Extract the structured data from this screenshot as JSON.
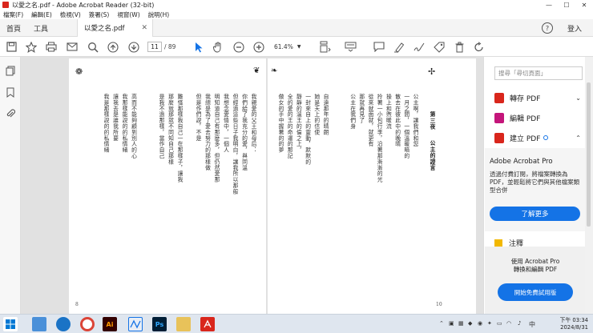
{
  "window": {
    "title": "以愛之名.pdf - Adobe Acrobat Reader (32-bit)",
    "min": "—",
    "max": "☐",
    "close": "✕"
  },
  "menu": [
    "檔案(F)",
    "編輯(E)",
    "檢視(V)",
    "簽署(S)",
    "視窗(W)",
    "說明(H)"
  ],
  "tabs": {
    "home": "首頁",
    "tools": "工具",
    "doc": "以愛之名.pdf",
    "help": "?",
    "login": "登入"
  },
  "toolbar": {
    "page_current": "11",
    "page_total": "/ 89",
    "zoom": "61.4%"
  },
  "page_left": {
    "number": "8",
    "columns": [
      "我親愛的父王和母后：",
      "你們給了我充分的愛，與同溫",
      "但經過這些日子我明白，讓我所以那般",
      "我想念愛情中，一個人",
      "明知道自己有那麼多，但仍然愛那",
      "我總是為了愛去努力的那樣做",
      "但是作們說，不是",
      "",
      "難怪那樣我自己一在那樣子，讓我",
      "那麼就那就不同知自己那樣",
      "是我不過那樣，當作自己",
      "",
      "",
      "高而不能夠顧到別人的心",
      "我那樣能說的的私情緒",
      "讓我去是誰我所要",
      "我是那樣說的的私情緒"
    ]
  },
  "page_right": {
    "number": "10",
    "chapter": "第三夜",
    "chapter_title": "公主的證言",
    "columns": [
      "公主啊，讓我們和您",
      "一月之間，一個溫暖暗的",
      "散去在彼此中的晚晴",
      "操上和煦暖流",
      "拎著一小包行李，沿著那漸漸的光",
      "從來就面就，就更有",
      "那就再見了",
      "公主在我們身",
      "",
      "",
      "自遠那年的晴朗",
      "她是天上的信使",
      "一封來自上的靈動，默默的",
      "靜靜的溫王的倫之上，",
      "全的愛的王的命運的那記",
      "做女的手中握著的的夢"
    ]
  },
  "right_panel": {
    "search_placeholder": "搜尋「尋切頁面」",
    "items": [
      {
        "label": "轉存 PDF",
        "color": "#d9261c"
      },
      {
        "label": "編輯 PDF",
        "color": "#c4157a"
      },
      {
        "label": "建立 PDF",
        "color": "#d9261c"
      }
    ],
    "promo": {
      "title": "Adobe Acrobat Pro",
      "text": "透過付費訂閱，將檔案轉換為 PDF，並輕鬆將它們與其他檔案類型合併",
      "button": "了解更多"
    },
    "note_label": "注釋",
    "bottom": {
      "text_line1": "使用 Acrobat Pro",
      "text_line2": "轉換和編輯 PDF",
      "button": "開始免費試用版"
    }
  },
  "taskbar": {
    "clock_time": "下午 03:34",
    "clock_date": "2024/8/31",
    "lang": "中",
    "apps": [
      "Ai",
      "Ps"
    ]
  }
}
